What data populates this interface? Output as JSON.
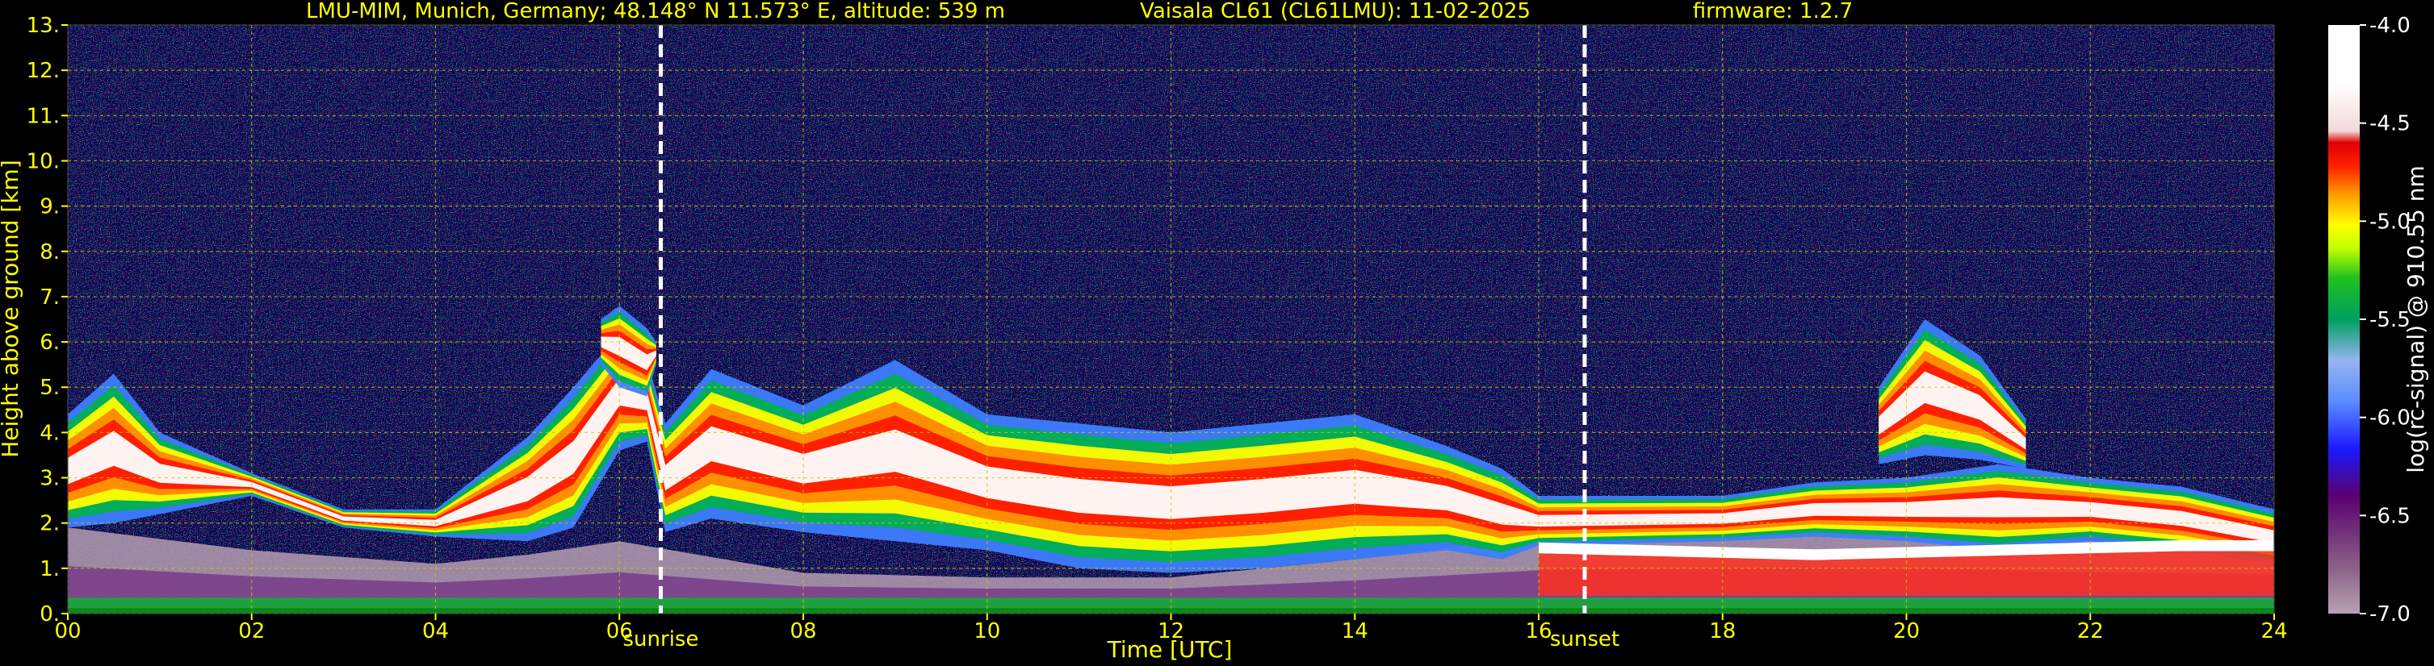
{
  "chart_data": {
    "type": "heatmap",
    "title": {
      "station": "LMU-MIM, Munich, Germany; 48.148° N 11.573° E, altitude: 539 m",
      "instrument": "Vaisala CL61 (CL61LMU): 11-02-2025",
      "firmware": "firmware: 1.2.7"
    },
    "xlabel": "Time [UTC]",
    "ylabel": "Height above ground [km]",
    "xlim": [
      0,
      24
    ],
    "ylim": [
      0,
      13
    ],
    "x_ticks": [
      "00",
      "02",
      "04",
      "06",
      "08",
      "10",
      "12",
      "14",
      "16",
      "18",
      "20",
      "22",
      "24"
    ],
    "y_ticks": [
      "0.",
      "1.",
      "2.",
      "3.",
      "4.",
      "5.",
      "6.",
      "7.",
      "8.",
      "9.",
      "10.",
      "11.",
      "12.",
      "13."
    ],
    "grid": true,
    "annotations": [
      {
        "label": "sunrise",
        "x": 6.45
      },
      {
        "label": "sunset",
        "x": 16.5
      }
    ],
    "colorbar": {
      "label": "log(rc-signal) @ 910.55 nm",
      "range": [
        -7.0,
        -4.0
      ],
      "ticks": [
        "-4.0",
        "-4.5",
        "-5.0",
        "-5.5",
        "-6.0",
        "-6.5",
        "-7.0"
      ]
    },
    "layers": [
      {
        "kind": "surface",
        "x": [
          0,
          24
        ],
        "base_km": 0,
        "top_km": 0.35
      },
      {
        "kind": "boundary_layer",
        "x": [
          0,
          2,
          4,
          5,
          6,
          8,
          10,
          12,
          14,
          16,
          18,
          20,
          22,
          24
        ],
        "top_km": [
          1.9,
          1.4,
          1.1,
          1.3,
          1.6,
          0.9,
          0.8,
          0.8,
          1.2,
          1.7,
          1.8,
          1.8,
          1.6,
          1.5
        ]
      },
      {
        "kind": "aerosol_cloud",
        "x": [
          0,
          0.5,
          1,
          2,
          3,
          4,
          5,
          5.5,
          6,
          6.3,
          6.5,
          7,
          8,
          9,
          10,
          11,
          12,
          13,
          14,
          15,
          15.6,
          16,
          18,
          19,
          20,
          21,
          22,
          23,
          24
        ],
        "base_km": [
          1.9,
          2.0,
          2.2,
          2.6,
          1.9,
          1.7,
          1.6,
          1.9,
          3.6,
          3.8,
          1.8,
          2.1,
          1.8,
          1.6,
          1.4,
          1.0,
          0.9,
          1.0,
          1.2,
          1.4,
          1.2,
          1.5,
          1.6,
          1.7,
          1.6,
          1.4,
          1.6,
          1.4,
          1.1
        ],
        "top_km": [
          4.4,
          5.3,
          4.0,
          3.1,
          2.3,
          2.3,
          3.9,
          5.0,
          6.2,
          5.6,
          4.2,
          5.4,
          4.6,
          5.6,
          4.4,
          4.2,
          4.0,
          4.2,
          4.4,
          3.7,
          3.2,
          2.6,
          2.6,
          2.9,
          3.0,
          3.3,
          3.0,
          2.8,
          2.3
        ]
      },
      {
        "kind": "plume",
        "x": [
          5.8,
          6.0,
          6.3,
          6.4
        ],
        "base_km": [
          5.5,
          5.0,
          4.8,
          5.5
        ],
        "top_km": [
          6.5,
          6.8,
          6.3,
          6.0
        ]
      },
      {
        "kind": "plume",
        "x": [
          19.7,
          20.2,
          20.8,
          21.3
        ],
        "base_km": [
          3.3,
          3.5,
          3.4,
          3.2
        ],
        "top_km": [
          5.0,
          6.5,
          5.7,
          4.3
        ]
      },
      {
        "kind": "cloud_layer",
        "x": [
          16,
          17,
          18,
          19,
          20,
          21,
          22,
          23,
          24
        ],
        "km": [
          1.45,
          1.4,
          1.35,
          1.3,
          1.35,
          1.4,
          1.45,
          1.5,
          1.5
        ]
      }
    ]
  }
}
